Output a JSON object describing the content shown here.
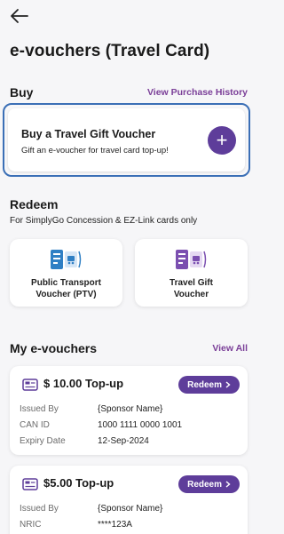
{
  "page": {
    "title": "e-vouchers (Travel Card)"
  },
  "buy": {
    "heading": "Buy",
    "history_link": "View Purchase History",
    "card_title": "Buy a Travel Gift Voucher",
    "card_subtitle": "Gift an e-voucher for travel card top-up!",
    "add_glyph": "+"
  },
  "redeem": {
    "heading": "Redeem",
    "subtitle": "For SimplyGo Concession & EZ-Link cards only",
    "options": [
      {
        "label_line1": "Public Transport",
        "label_line2": "Voucher (PTV)"
      },
      {
        "label_line1": "Travel Gift",
        "label_line2": "Voucher"
      }
    ]
  },
  "my_vouchers": {
    "heading": "My e-vouchers",
    "view_all": "View All",
    "items": [
      {
        "title": "$ 10.00 Top-up",
        "redeem_label": "Redeem",
        "rows": [
          {
            "key": "Issued By",
            "value": "{Sponsor Name}"
          },
          {
            "key": "CAN ID",
            "value": "1000 1111 0000 1001"
          },
          {
            "key": "Expiry Date",
            "value": "12-Sep-2024"
          }
        ]
      },
      {
        "title": "$5.00 Top-up",
        "redeem_label": "Redeem",
        "rows": [
          {
            "key": "Issued By",
            "value": "{Sponsor Name}"
          },
          {
            "key": "NRIC",
            "value": "****123A"
          }
        ]
      }
    ]
  },
  "colors": {
    "accent": "#5e3d9a",
    "link": "#7b3f98",
    "focus_border": "#3b6fb6",
    "background": "#f6f6f8"
  },
  "icons": [
    "back-arrow-icon",
    "plus-icon",
    "ptv-card-icon",
    "gift-card-icon",
    "voucher-ticket-icon",
    "chevron-right-icon"
  ]
}
